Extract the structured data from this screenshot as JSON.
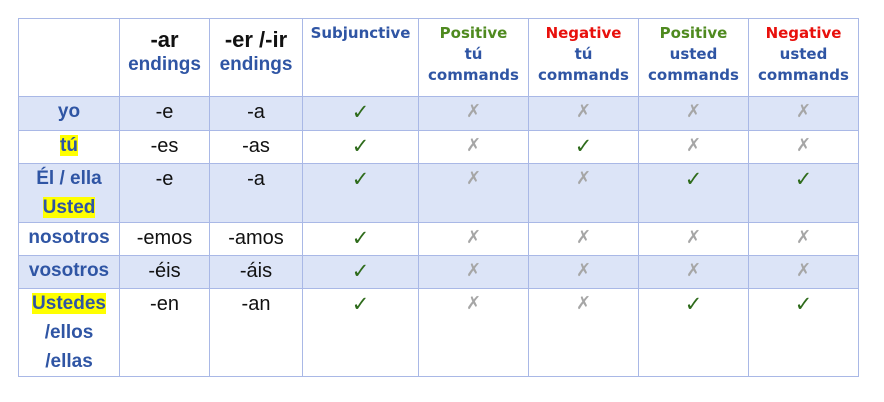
{
  "headers": {
    "ar_big": "-ar",
    "ar_sub": "endings",
    "er_big": "-er /-ir",
    "er_sub": "endings",
    "subjunctive": "Subjunctive",
    "pos_tu_1": "Positive",
    "pos_tu_2": "tú",
    "pos_tu_3": "commands",
    "neg_tu_1": "Negative",
    "neg_tu_2": "tú",
    "neg_tu_3": "commands",
    "pos_usted_1": "Positive",
    "pos_usted_2": "usted",
    "pos_usted_3": "commands",
    "neg_usted_1": "Negative",
    "neg_usted_2": "usted",
    "neg_usted_3": "commands"
  },
  "rows": [
    {
      "pronoun_a": "yo",
      "ar": "-e",
      "er": "-a",
      "sub": "✓",
      "pos_tu": "✗",
      "neg_tu": "✗",
      "pos_usted": "✗",
      "neg_usted": "✗"
    },
    {
      "pronoun_a": "tú",
      "ar": "-es",
      "er": "-as",
      "sub": "✓",
      "pos_tu": "✗",
      "neg_tu": "✓",
      "pos_usted": "✗",
      "neg_usted": "✗"
    },
    {
      "pronoun_a": "Él / ella",
      "pronoun_b": "Usted",
      "ar": "-e",
      "er": "-a",
      "sub": "✓",
      "pos_tu": "✗",
      "neg_tu": "✗",
      "pos_usted": "✓",
      "neg_usted": "✓"
    },
    {
      "pronoun_a": "nosotros",
      "ar": "-emos",
      "er": "-amos",
      "sub": "✓",
      "pos_tu": "✗",
      "neg_tu": "✗",
      "pos_usted": "✗",
      "neg_usted": "✗"
    },
    {
      "pronoun_a": "vosotros",
      "ar": "-éis",
      "er": "-áis",
      "sub": "✓",
      "pos_tu": "✗",
      "neg_tu": "✗",
      "pos_usted": "✗",
      "neg_usted": "✗"
    },
    {
      "pronoun_a": "Ustedes",
      "pronoun_b": "/ellos",
      "pronoun_c": "/ellas",
      "ar": "-en",
      "er": "-an",
      "sub": "✓",
      "pos_tu": "✗",
      "neg_tu": "✗",
      "pos_usted": "✓",
      "neg_usted": "✓"
    }
  ],
  "colors": {
    "border": "#a9b8e6",
    "row_shade": "#dce4f7",
    "blue_text": "#2f55a4",
    "green_text": "#4f8a1f",
    "red_text": "#e8100c",
    "check": "#2e6b1b",
    "cross": "#a6a6a6",
    "highlight": "#ffff00"
  }
}
